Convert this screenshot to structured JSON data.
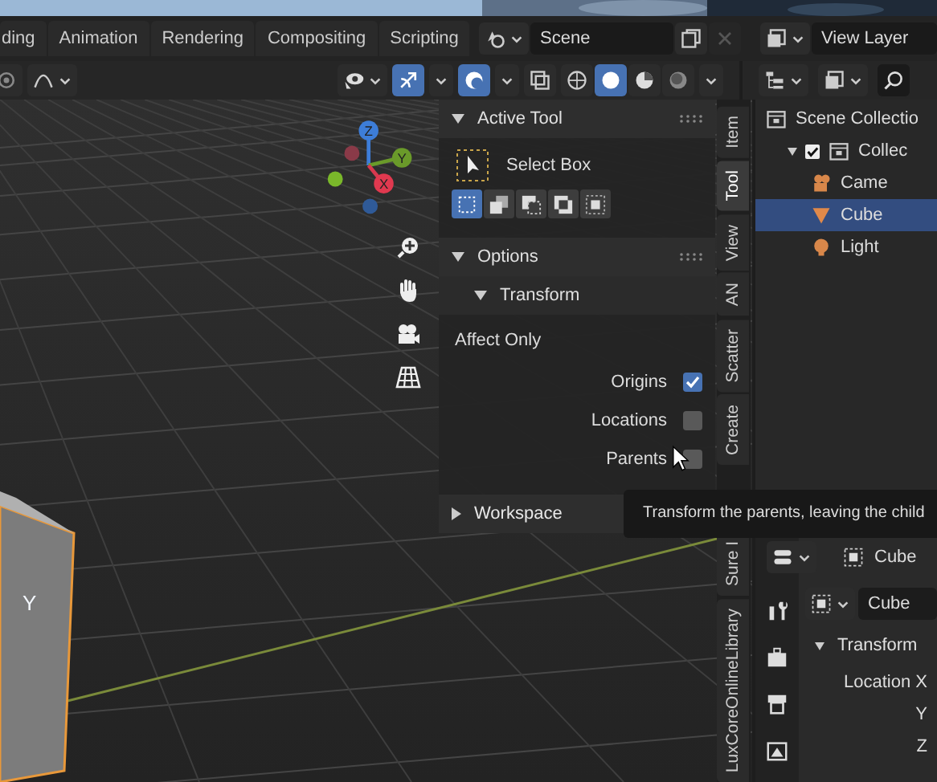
{
  "workspace_tabs": [
    {
      "label": "ding"
    },
    {
      "label": "Animation"
    },
    {
      "label": "Rendering"
    },
    {
      "label": "Compositing"
    },
    {
      "label": "Scripting"
    }
  ],
  "scene": {
    "name": "Scene"
  },
  "view_layer": {
    "name": "View Layer"
  },
  "viewport": {
    "gizmos_on": true,
    "overlays_on": true,
    "xray_on": false,
    "shading_modes": [
      {
        "kind": "wireframe",
        "selected": false
      },
      {
        "kind": "solid",
        "selected": true
      },
      {
        "kind": "material",
        "selected": false
      },
      {
        "kind": "rendered",
        "selected": false
      }
    ],
    "gizmo_axes": [
      "Z",
      "Y",
      "X"
    ],
    "cube_axis_label": "Y"
  },
  "sidebar": {
    "tabs": [
      {
        "label": "Item",
        "selected": false
      },
      {
        "label": "Tool",
        "selected": true
      },
      {
        "label": "View",
        "selected": false
      },
      {
        "label": "AN",
        "selected": false
      },
      {
        "label": "Scatter",
        "selected": false
      },
      {
        "label": "Create",
        "selected": false
      },
      {
        "label": "Sure I",
        "selected": false
      },
      {
        "label": "LuxCoreOnlineLibrary",
        "selected": false
      }
    ],
    "active_tool": {
      "title": "Active Tool",
      "expanded": true,
      "tool": "Select Box",
      "modes": [
        {
          "kind": "set",
          "selected": true
        },
        {
          "kind": "extend",
          "selected": false
        },
        {
          "kind": "subtract",
          "selected": false
        },
        {
          "kind": "difference",
          "selected": false
        },
        {
          "kind": "intersect",
          "selected": false
        }
      ]
    },
    "options": {
      "title": "Options",
      "expanded": true,
      "subpanel": {
        "title": "Transform",
        "expanded": true
      },
      "affect_label": "Affect Only",
      "checks": [
        {
          "label": "Origins",
          "checked": true
        },
        {
          "label": "Locations",
          "checked": false
        },
        {
          "label": "Parents",
          "checked": false
        }
      ]
    },
    "workspace": {
      "title": "Workspace",
      "expanded": false
    }
  },
  "tooltip": "Transform the parents, leaving the child",
  "outliner": {
    "items": [
      {
        "label": "Scene Collectio",
        "kind": "collection",
        "children": [
          {
            "label": "Collec",
            "kind": "collection",
            "checked": true,
            "expanded": true,
            "children": [
              {
                "label": "Came",
                "kind": "camera",
                "selected": false
              },
              {
                "label": "Cube",
                "kind": "mesh",
                "selected": true
              },
              {
                "label": "Light",
                "kind": "light",
                "selected": false
              }
            ]
          }
        ]
      }
    ]
  },
  "properties": {
    "object_name": "Cube",
    "data_name": "Cube",
    "section": {
      "title": "Transform",
      "expanded": true
    },
    "fields": [
      "Location X",
      "Y",
      "Z"
    ]
  }
}
